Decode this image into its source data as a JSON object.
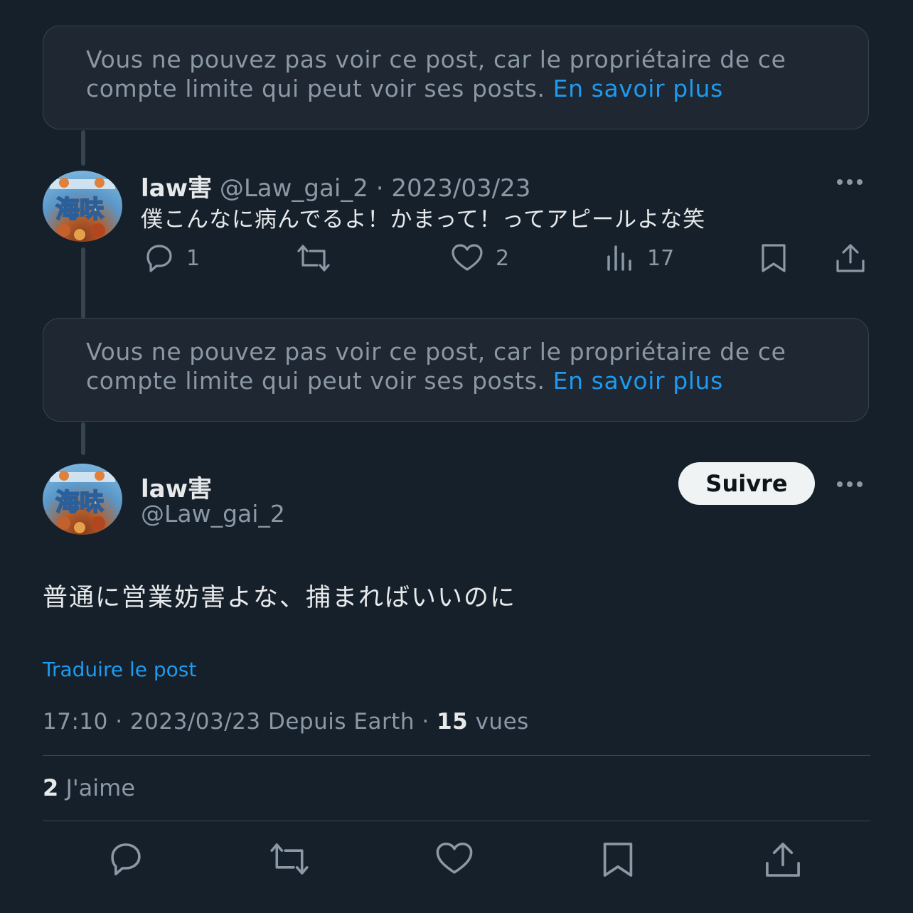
{
  "notices": [
    {
      "text": "Vous ne pouvez pas voir ce post, car le propriétaire de ce compte limite qui peut voir ses posts.",
      "link": "En savoir plus"
    },
    {
      "text": "Vous ne pouvez pas voir ce post, car le propriétaire de ce compte limite qui peut voir ses posts.",
      "link": "En savoir plus"
    }
  ],
  "reply": {
    "display_name": "law害",
    "handle": "@Law_gai_2",
    "separator": "·",
    "date": "2023/03/23",
    "text": "僕こんなに病んでるよ！かまって！ってアピールよな笑",
    "reply_count": "1",
    "like_count": "2",
    "view_count": "17",
    "avatar_text": "海味"
  },
  "main_post": {
    "display_name": "law害",
    "handle": "@Law_gai_2",
    "follow_label": "Suivre",
    "text": "普通に営業妨害よな、捕まればいいのに",
    "translate_label": "Traduire le post",
    "time": "17:10",
    "sep1": "·",
    "date": "2023/03/23",
    "source": "Depuis Earth",
    "sep2": "·",
    "views": "15",
    "views_label": "vues",
    "likes": "2",
    "likes_label": "J'aime",
    "avatar_text": "海味"
  },
  "icons": [
    "reply-icon",
    "retweet-icon",
    "like-icon",
    "views-icon",
    "bookmark-icon",
    "share-icon",
    "more-icon"
  ],
  "colors": {
    "background": "#15202b",
    "text": "#e7e9ea",
    "muted": "#8b98a5",
    "link": "#1d9bf0",
    "border": "#38444d"
  }
}
